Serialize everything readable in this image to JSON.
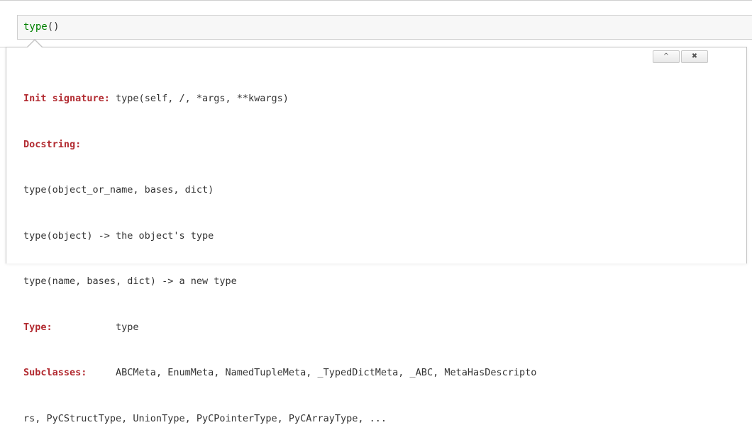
{
  "cell": {
    "code_fn": "type",
    "code_args": "()"
  },
  "tooltip": {
    "expand_button_glyph": "^",
    "close_button_glyph": "✖",
    "init_signature_label": "Init signature:",
    "init_signature_value": " type(self, /, *args, **kwargs)",
    "docstring_label": "Docstring:",
    "docstring_lines": [
      "type(object_or_name, bases, dict)",
      "type(object) -> the object's type",
      "type(name, bases, dict) -> a new type"
    ],
    "type_label": "Type:",
    "type_value": "           type",
    "subclasses_label": "Subclasses:",
    "subclasses_value": "     ABCMeta, EnumMeta, NamedTupleMeta, _TypedDictMeta, _ABC, MetaHasDescripto",
    "subclasses_wrap": "rs, PyCStructType, UnionType, PyCPointerType, PyCArrayType, ..."
  },
  "colors": {
    "label": "#b22b31",
    "function_name": "#008000",
    "text": "#333333"
  }
}
